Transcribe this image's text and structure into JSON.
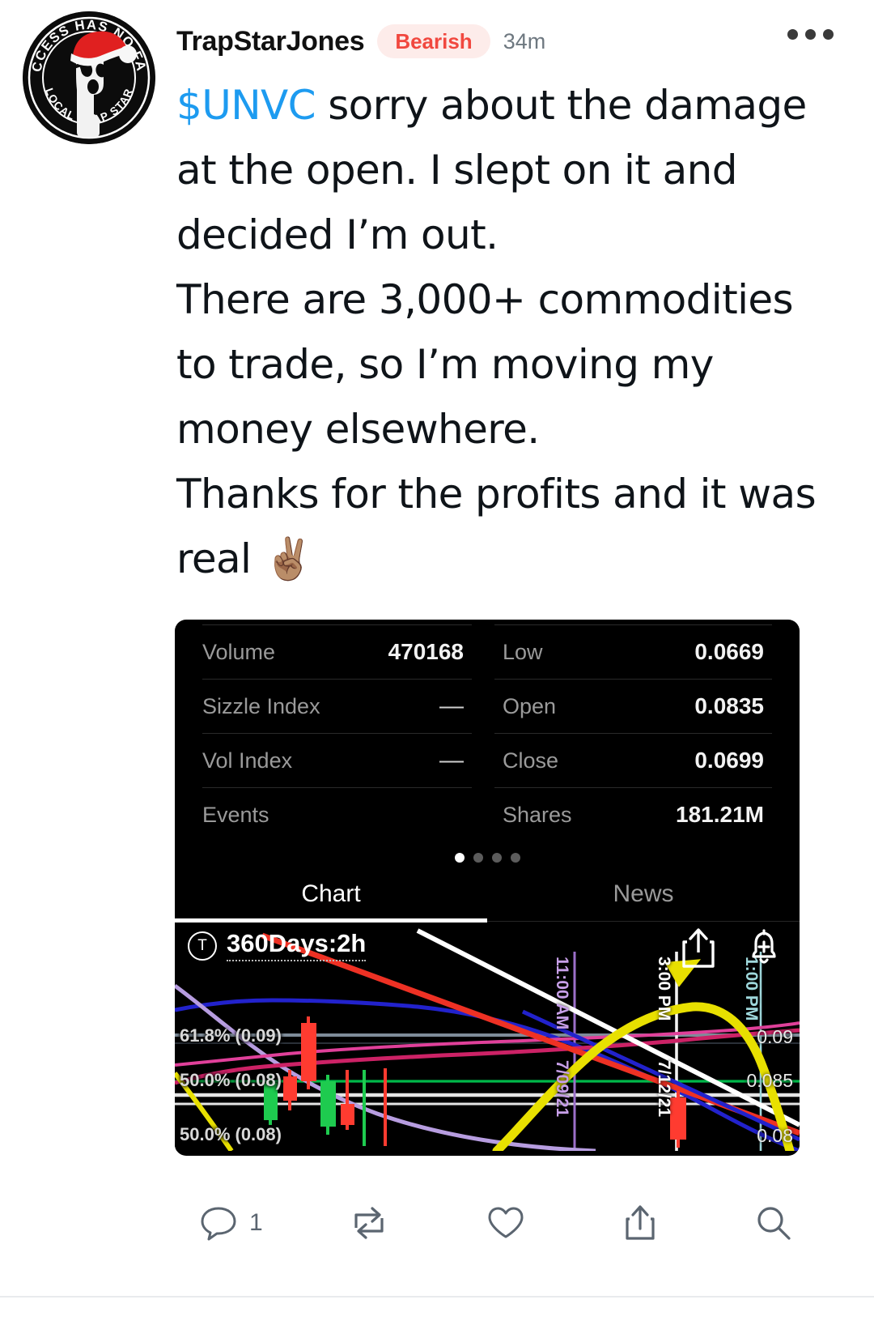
{
  "header": {
    "username": "TrapStarJones",
    "sentiment": "Bearish",
    "timestamp": "34m",
    "menu_icon": "more-horizontal-icon",
    "avatar": {
      "top_text": "SUCCESS HAS NO FACE",
      "bottom_text": "LOCAL TRAP STAR"
    }
  },
  "post": {
    "cashtag": "$UNVC",
    "line1": " sorry about the damage at the open. I slept on it and decided I’m out.",
    "line2": "There are 3,000+ commodities to trade, so I’m moving my money elsewhere.",
    "line3": "Thanks for the profits and it was real ",
    "emoji": "✌🏽"
  },
  "quote_card": {
    "stats": [
      {
        "label": "Volume",
        "value": "470168",
        "label2": "Low",
        "value2": "0.0669"
      },
      {
        "label": "Sizzle Index",
        "value": "—",
        "label2": "Open",
        "value2": "0.0835"
      },
      {
        "label": "Vol Index",
        "value": "—",
        "label2": "Close",
        "value2": "0.0699"
      },
      {
        "label": "Events",
        "value": "",
        "label2": "Shares",
        "value2": "181.21M"
      }
    ],
    "pager": {
      "count": 4,
      "active": 0
    },
    "tabs": [
      {
        "label": "Chart",
        "active": true
      },
      {
        "label": "News",
        "active": false
      }
    ],
    "chart": {
      "timeframe_icon": "T",
      "timeframe": "360Days:2h",
      "share_icon": "share-up-icon",
      "alert_icon": "bell-add-icon",
      "fib_labels": [
        {
          "text": "61.8% (0.09)"
        },
        {
          "text": "50.0% (0.08)"
        },
        {
          "text": "50.0% (0.08)"
        }
      ],
      "axis_labels": [
        {
          "text": "11:00 AM",
          "color": "#b57edc"
        },
        {
          "text": "7/09/21",
          "color": "#b57edc"
        },
        {
          "text": "3:00 PM",
          "color": "#ffffff"
        },
        {
          "text": "7/12/21",
          "color": "#ffffff"
        },
        {
          "text": "1:00 PM",
          "color": "#7fd4d8"
        }
      ],
      "price_labels": [
        {
          "text": "0.09"
        },
        {
          "text": "0.085"
        },
        {
          "text": "0.08"
        }
      ]
    }
  },
  "chart_data": {
    "type": "line",
    "title": "360Days:2h",
    "xlabel": "",
    "ylabel": "",
    "ylim": [
      0.0669,
      0.0935
    ],
    "grid": true,
    "legend": "none",
    "annotations": [
      "61.8% (0.09)",
      "50.0% (0.08)"
    ],
    "ticks_x": [
      "11:00 AM 7/09/21",
      "3:00 PM 7/12/21",
      "1:00 PM"
    ],
    "ticks_y": [
      "0.09",
      "0.085",
      "0.08"
    ],
    "series": [
      {
        "name": "fib-61.8",
        "color": "#7e8c99",
        "values": [
          0.09,
          0.09
        ]
      },
      {
        "name": "fib-50.0",
        "color": "#00c853",
        "values": [
          0.08,
          0.08
        ]
      },
      {
        "name": "trend-red",
        "color": "#ee3124",
        "values": [
          0.0935,
          0.0669
        ]
      },
      {
        "name": "trend-white",
        "color": "#ffffff",
        "values": [
          0.0928,
          0.0675
        ]
      },
      {
        "name": "ma-blue",
        "color": "#2222cc",
        "values": [
          0.0875,
          0.0872,
          0.0874,
          0.0872,
          0.0866,
          0.0855,
          0.0838,
          0.0818,
          0.0795
        ]
      },
      {
        "name": "ma-pink",
        "color": "#cc2266",
        "values": [
          0.0796,
          0.0801,
          0.0812,
          0.0821,
          0.0824,
          0.0826,
          0.0828,
          0.0829,
          0.0828
        ]
      },
      {
        "name": "ma-violet",
        "color": "#b57edc",
        "values": [
          0.0905,
          0.0855,
          0.0812,
          0.0789,
          0.0778,
          0.0772,
          0.0768,
          0.0765,
          0.0762
        ]
      },
      {
        "name": "ma-yellow",
        "color": "#e8e000",
        "values": [
          0.0742,
          0.0765,
          0.0806,
          0.0861,
          0.0896,
          0.0901,
          0.0884,
          0.0825,
          0.0741
        ]
      }
    ],
    "candles": [
      {
        "o": 0.0792,
        "h": 0.081,
        "l": 0.0784,
        "c": 0.0806,
        "dir": "up"
      },
      {
        "o": 0.0806,
        "h": 0.0812,
        "l": 0.079,
        "c": 0.0793,
        "dir": "down"
      },
      {
        "o": 0.0835,
        "h": 0.0852,
        "l": 0.0795,
        "c": 0.08,
        "dir": "down"
      },
      {
        "o": 0.0799,
        "h": 0.0812,
        "l": 0.0786,
        "c": 0.081,
        "dir": "up"
      },
      {
        "o": 0.081,
        "h": 0.0814,
        "l": 0.0782,
        "c": 0.0789,
        "dir": "down"
      },
      {
        "o": 0.0788,
        "h": 0.0818,
        "l": 0.078,
        "c": 0.0812,
        "dir": "up"
      },
      {
        "o": 0.0812,
        "h": 0.0828,
        "l": 0.08,
        "c": 0.0815,
        "dir": "up"
      },
      {
        "o": 0.0835,
        "h": 0.0838,
        "l": 0.0699,
        "c": 0.0699,
        "dir": "down"
      }
    ]
  },
  "actions": [
    {
      "name": "reply",
      "icon": "comment-icon",
      "count": "1"
    },
    {
      "name": "repost",
      "icon": "retweet-icon",
      "count": ""
    },
    {
      "name": "like",
      "icon": "heart-icon",
      "count": ""
    },
    {
      "name": "share",
      "icon": "share-icon",
      "count": ""
    },
    {
      "name": "search",
      "icon": "search-icon",
      "count": ""
    }
  ],
  "colors": {
    "cashtag_blue": "#1d9bf0",
    "bearish_red": "#f1483f",
    "bearish_bg": "#fdecea",
    "muted": "#6e7880",
    "card_bg": "#000000"
  }
}
